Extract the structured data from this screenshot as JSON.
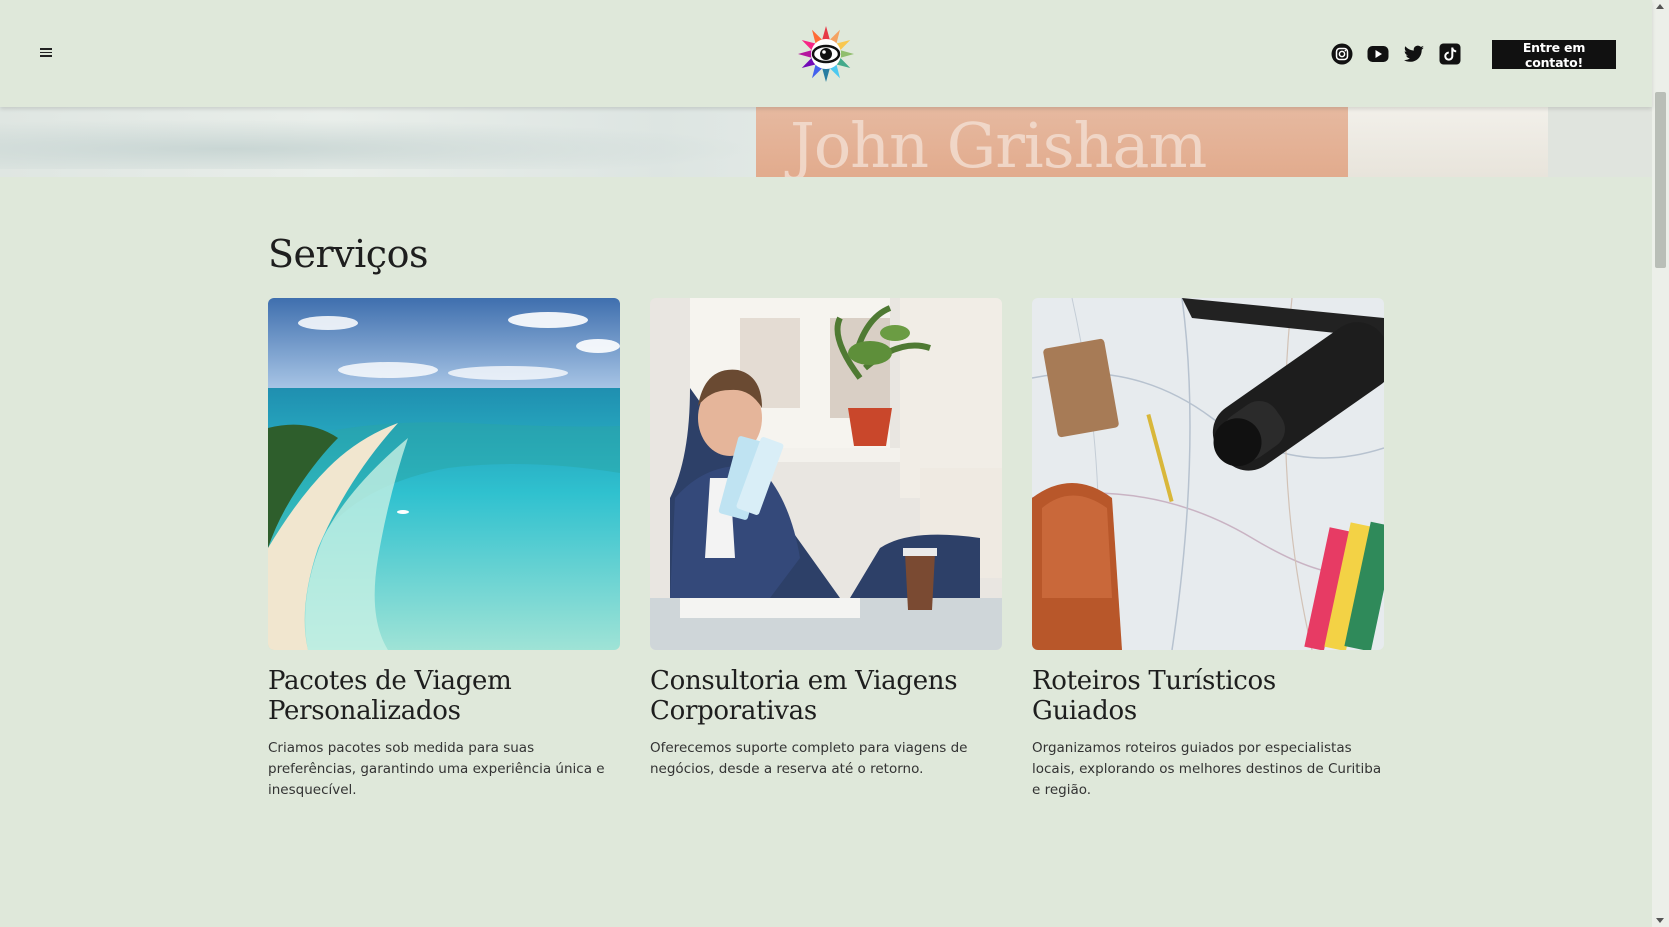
{
  "header": {
    "menu_icon": "hamburger-menu-icon",
    "logo_icon": "rainbow-eye-logo",
    "social": [
      {
        "name": "instagram",
        "icon": "instagram-icon"
      },
      {
        "name": "youtube",
        "icon": "youtube-icon"
      },
      {
        "name": "twitter",
        "icon": "twitter-icon"
      },
      {
        "name": "tiktok",
        "icon": "tiktok-icon"
      }
    ],
    "cta_label": "Entre em contato!"
  },
  "hero": {
    "book_text": "John Grisham"
  },
  "services": {
    "title": "Serviços",
    "cards": [
      {
        "title": "Pacotes de Viagem Personalizados",
        "text": "Criamos pacotes sob medida para suas preferências, garantindo uma experiência única e inesquecível.",
        "image": "tropical-beach-aerial"
      },
      {
        "title": "Consultoria em Viagens Corporativas",
        "text": "Oferecemos suporte completo para viagens de negócios, desde a reserva até o retorno.",
        "image": "businessman-with-tickets"
      },
      {
        "title": "Roteiros Turísticos Guiados",
        "text": "Organizamos roteiros guiados por especialistas locais, explorando os melhores destinos de Curitiba e região.",
        "image": "map-camera-notebook"
      }
    ]
  },
  "colors": {
    "background": "#dfe8da",
    "cta_background": "#111111",
    "text": "#1e1e1e"
  }
}
